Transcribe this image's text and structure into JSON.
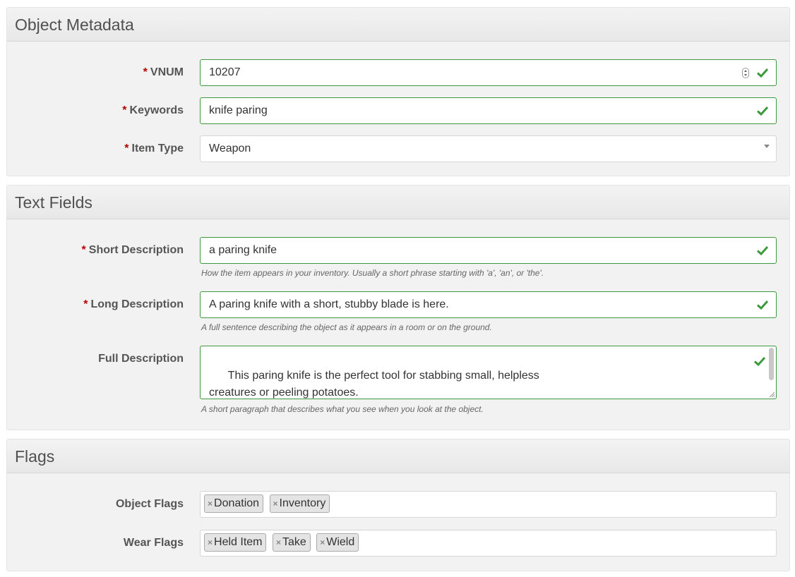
{
  "colors": {
    "valid_border": "#3c9a3c",
    "check": "#3c9a3c",
    "required_asterisk": "#b30000",
    "panel_bg": "#f2f2f2"
  },
  "icons": {
    "valid": "checkmark-icon",
    "number_spinner": "spinner-icon",
    "dropdown": "caret-down-icon",
    "tag_remove": "x-icon",
    "textarea_resize": "resize-handle-icon"
  },
  "required_marker": "*",
  "metadata": {
    "title": "Object Metadata",
    "vnum": {
      "label": "VNUM",
      "value": "10207"
    },
    "keywords": {
      "label": "Keywords",
      "value": "knife paring"
    },
    "item_type": {
      "label": "Item Type",
      "value": "Weapon"
    }
  },
  "text_fields": {
    "title": "Text Fields",
    "short_desc": {
      "label": "Short Description",
      "value": "a paring knife",
      "help": "How the item appears in your inventory. Usually a short phrase starting with 'a', 'an', or 'the'."
    },
    "long_desc": {
      "label": "Long Description",
      "value": "A paring knife with a short, stubby blade is here.",
      "help": "A full sentence describing the object as it appears in a room or on the ground."
    },
    "full_desc": {
      "label": "Full Description",
      "value": "This paring knife is the perfect tool for stabbing small, helpless\ncreatures or peeling potatoes.",
      "help": "A short paragraph that describes what you see when you look at the object."
    }
  },
  "flags": {
    "title": "Flags",
    "object_flags": {
      "label": "Object Flags",
      "tags": [
        "Donation",
        "Inventory"
      ]
    },
    "wear_flags": {
      "label": "Wear Flags",
      "tags": [
        "Held Item",
        "Take",
        "Wield"
      ]
    }
  },
  "tag_remove_glyph": "×"
}
